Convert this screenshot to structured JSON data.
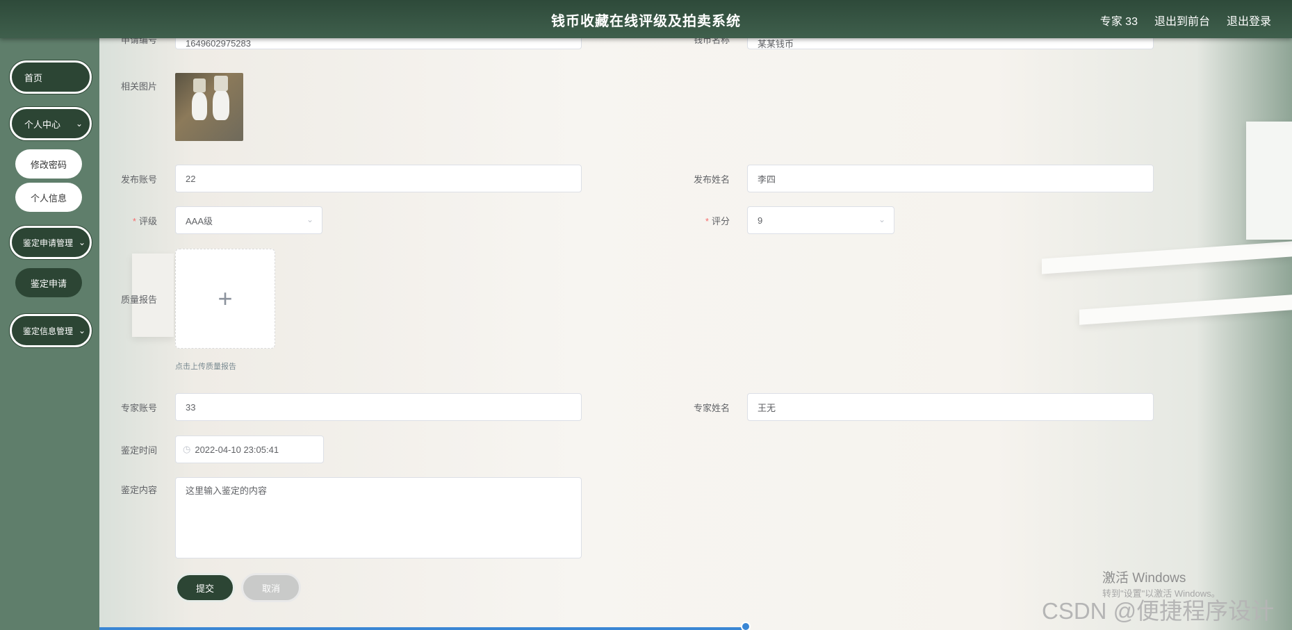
{
  "header": {
    "title": "钱币收藏在线评级及拍卖系统",
    "user": "专家 33",
    "front": "退出到前台",
    "logout": "退出登录"
  },
  "sidebar": {
    "home": "首页",
    "personal_center": "个人中心",
    "change_password": "修改密码",
    "personal_info": "个人信息",
    "appraisal_apply_mgmt": "鉴定申请管理",
    "appraisal_apply": "鉴定申请",
    "appraisal_info_mgmt": "鉴定信息管理"
  },
  "form": {
    "apply_no_label": "申请编号",
    "apply_no_value": "1649602975283",
    "coin_name_label": "钱币名称",
    "coin_name_value": "某某钱币",
    "image_label": "相关图片",
    "publisher_account_label": "发布账号",
    "publisher_account_value": "22",
    "publisher_name_label": "发布姓名",
    "publisher_name_value": "李四",
    "grade_label": "评级",
    "grade_value": "AAA级",
    "score_label": "评分",
    "score_value": "9",
    "quality_report_label": "质量报告",
    "upload_hint": "点击上传质量报告",
    "expert_account_label": "专家账号",
    "expert_account_value": "33",
    "expert_name_label": "专家姓名",
    "expert_name_value": "王无",
    "time_label": "鉴定时间",
    "time_value": "2022-04-10 23:05:41",
    "content_label": "鉴定内容",
    "content_value": "这里输入鉴定的内容",
    "submit": "提交",
    "cancel": "取消"
  },
  "watermarks": {
    "activate_title": "激活 Windows",
    "activate_sub": "转到\"设置\"以激活 Windows。",
    "csdn": "CSDN @便捷程序设计"
  },
  "colors": {
    "header": "#3f5f4c",
    "sidebar": "#5f7e6b",
    "accent": "#2c4534",
    "required": "#f56c6c"
  },
  "icons": {
    "chevron": "chevron-down-icon",
    "plus": "plus-icon",
    "clock": "clock-icon"
  }
}
